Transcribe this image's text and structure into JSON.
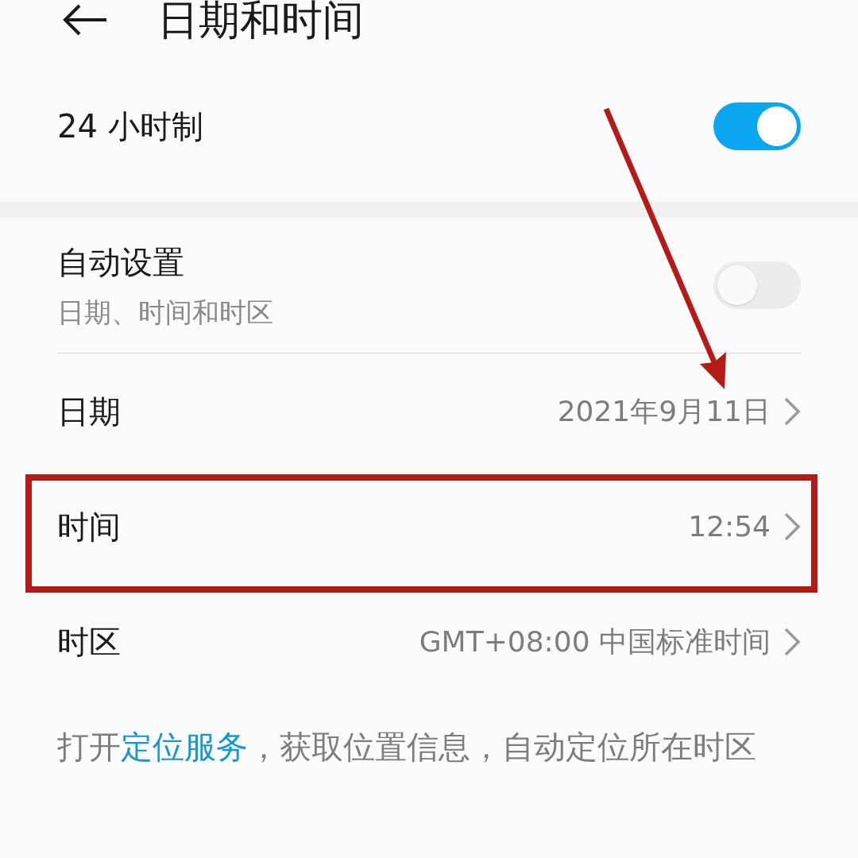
{
  "header": {
    "title": "日期和时间"
  },
  "sections": [
    {
      "rows": [
        {
          "kind": "toggle",
          "label": "24 小时制",
          "on": true
        }
      ]
    },
    {
      "rows": [
        {
          "kind": "toggle",
          "label": "自动设置",
          "subtitle": "日期、时间和时区",
          "on": false
        },
        {
          "kind": "value",
          "label": "日期",
          "value": "2021年9月11日"
        },
        {
          "kind": "value",
          "label": "时间",
          "value": "12:54"
        },
        {
          "kind": "value",
          "label": "时区",
          "value": "GMT+08:00 中国标准时间"
        }
      ]
    }
  ],
  "footer": {
    "text_before": "打开",
    "link": "定位服务",
    "text_after": "，获取位置信息，自动定位所在时区"
  }
}
